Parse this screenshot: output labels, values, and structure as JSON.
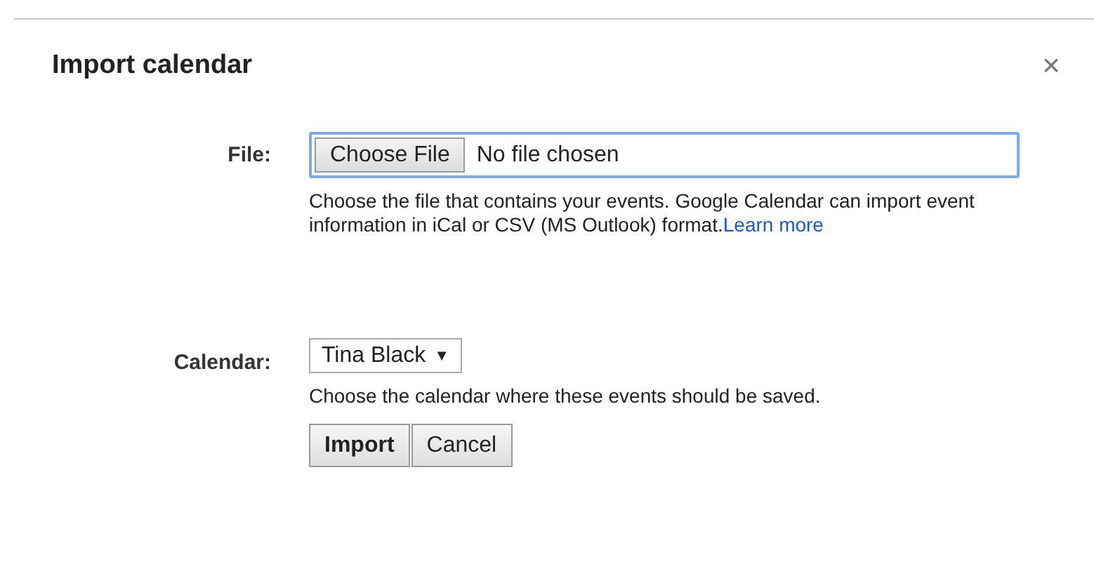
{
  "dialog": {
    "title": "Import calendar",
    "close": "×"
  },
  "file": {
    "label": "File:",
    "button": "Choose File",
    "value": "No file chosen",
    "help": "Choose the file that contains your events. Google Calendar can import event information in iCal or CSV (MS Outlook) format.",
    "link": "Learn more"
  },
  "calendar": {
    "label": "Calendar:",
    "value": "Tina Black",
    "caret": "▼",
    "help": "Choose the calendar where these events should be saved."
  },
  "buttons": [
    {
      "label": "Import",
      "kind": "primary"
    },
    {
      "label": "Cancel",
      "kind": "secondary"
    }
  ]
}
